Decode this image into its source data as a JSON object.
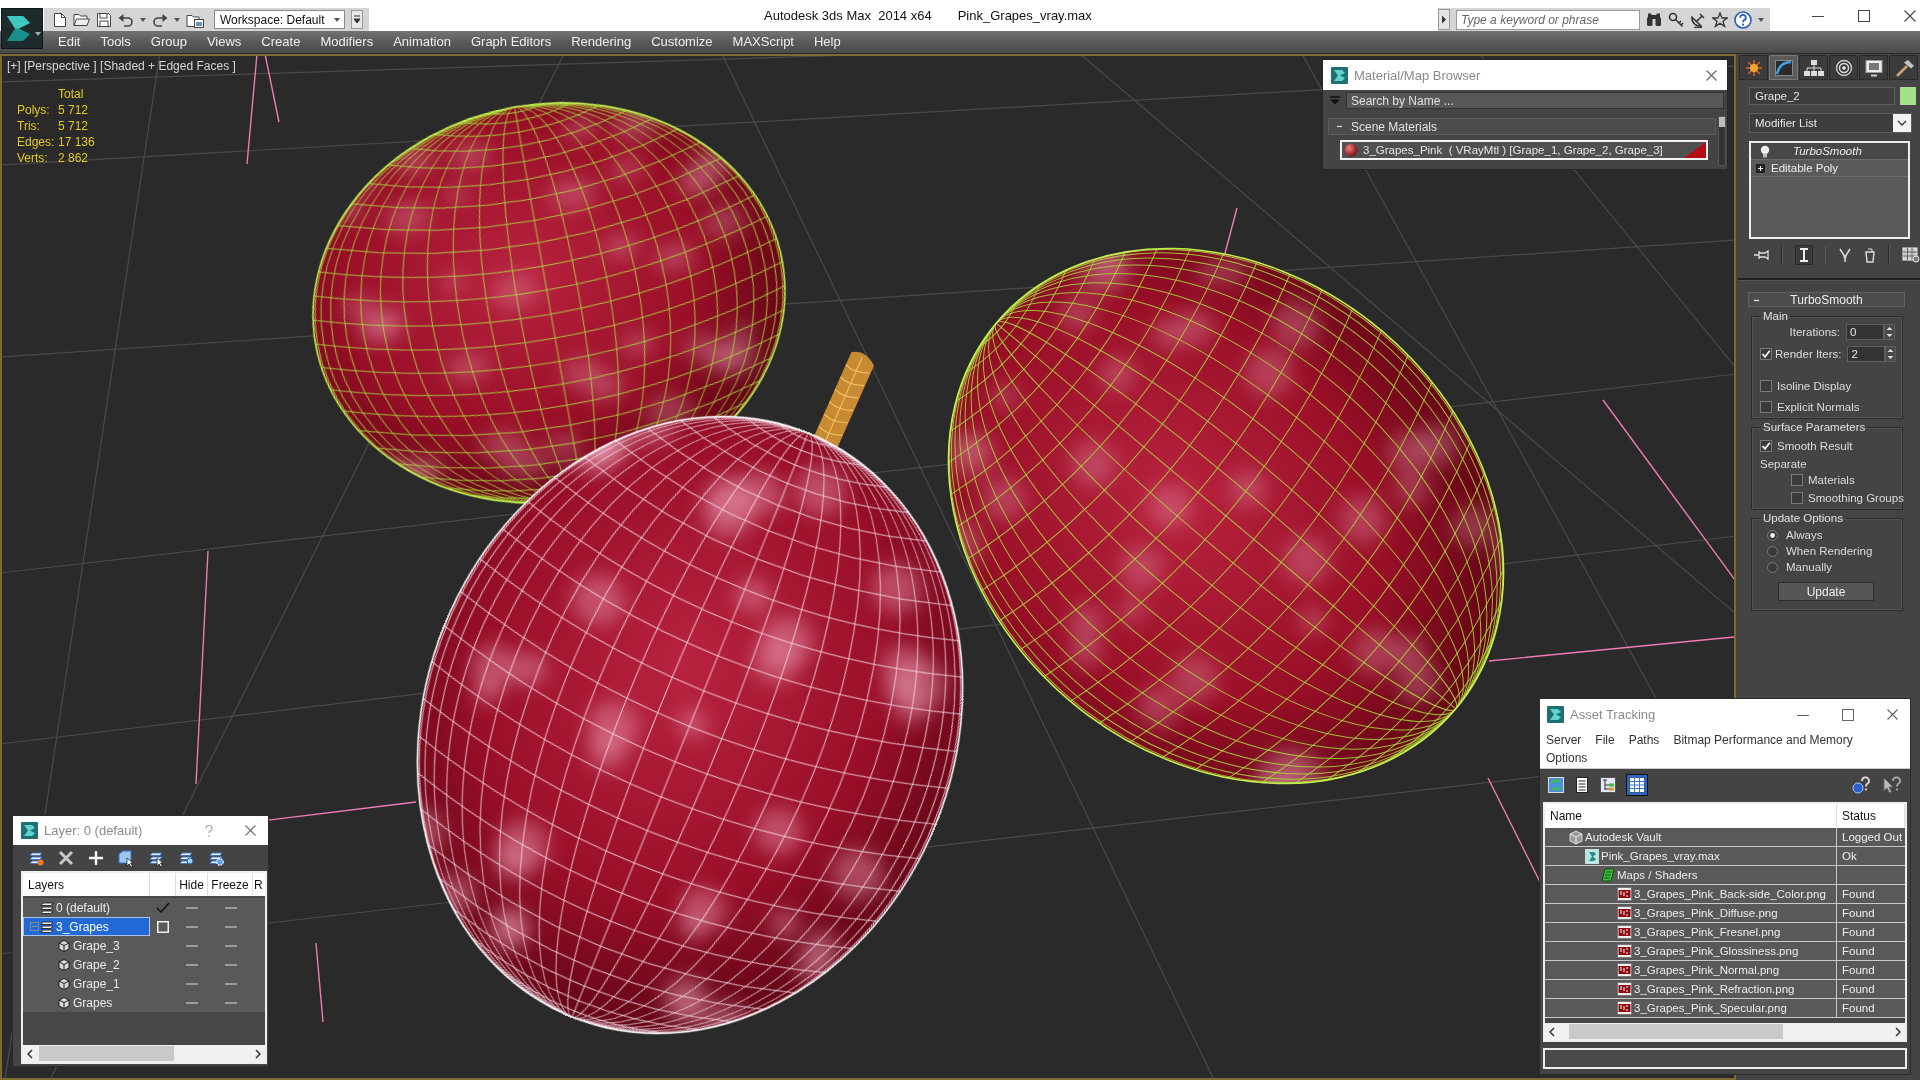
{
  "title_bar": {
    "workspace": "Workspace: Default",
    "app_title": "Autodesk 3ds Max  2014 x64",
    "file_name": "Pink_Grapes_vray.max",
    "search": {
      "placeholder": "Type a keyword or phrase"
    }
  },
  "menu_bar": [
    "Edit",
    "Tools",
    "Group",
    "Views",
    "Create",
    "Modifiers",
    "Animation",
    "Graph Editors",
    "Rendering",
    "Customize",
    "MAXScript",
    "Help"
  ],
  "viewport": {
    "label": "[+] [Perspective ] [Shaded + Edged Faces ]",
    "stats": {
      "header": "Total",
      "rows": [
        {
          "label": "Polys:",
          "value": "5 712"
        },
        {
          "label": "Tris:",
          "value": "5 712"
        },
        {
          "label": "Edges:",
          "value": "17 136"
        },
        {
          "label": "Verts:",
          "value": "2 862"
        }
      ]
    },
    "objects": [
      {
        "selected": false
      },
      {
        "selected": true
      },
      {
        "selected": false
      }
    ]
  },
  "material_browser": {
    "title": "Material/Map Browser",
    "search": {
      "placeholder": "Search by Name ..."
    },
    "group": {
      "title": "Scene Materials",
      "expanded": true,
      "items": [
        {
          "label": "3_Grapes_Pink  ( VRayMtl ) [Grape_1, Grape_2, Grape_3]",
          "selected": true
        }
      ]
    }
  },
  "command_panel": {
    "tabs": [
      {
        "selected": false
      },
      {
        "selected": true
      },
      {
        "selected": false
      },
      {
        "selected": false
      },
      {
        "selected": false
      },
      {
        "selected": false
      }
    ],
    "object_name": "Grape_2",
    "modifier_list": "Modifier List",
    "stack": [
      {
        "label": "TurboSmooth",
        "kind": "modifier",
        "selected": true,
        "italic": true
      },
      {
        "label": "Editable Poly",
        "kind": "base",
        "selected": false,
        "italic": false
      }
    ],
    "rollout": {
      "title": "TurboSmooth",
      "expanded": true,
      "groups": [
        {
          "title": "Main",
          "controls": [
            {
              "kind": "spinner",
              "label": "Iterations:",
              "value": "0"
            },
            {
              "kind": "check_spinner",
              "label": "Render Iters:",
              "value": "2",
              "checked": true
            },
            {
              "kind": "checkbox",
              "label": "Isoline Display",
              "checked": false
            },
            {
              "kind": "checkbox",
              "label": "Explicit Normals",
              "checked": false
            }
          ]
        },
        {
          "title": "Surface Parameters",
          "controls": [
            {
              "kind": "checkbox",
              "label": "Smooth Result",
              "checked": true
            },
            {
              "kind": "label",
              "label": "Separate",
              "children": [
                {
                  "kind": "checkbox",
                  "label": "Materials",
                  "checked": false
                },
                {
                  "kind": "checkbox",
                  "label": "Smoothing Groups",
                  "checked": false
                }
              ]
            }
          ]
        },
        {
          "title": "Update Options",
          "controls": [
            {
              "kind": "radio",
              "label": "Always",
              "selected": true
            },
            {
              "kind": "radio",
              "label": "When Rendering",
              "selected": false
            },
            {
              "kind": "radio",
              "label": "Manually",
              "selected": false
            },
            {
              "kind": "button",
              "label": "Update"
            }
          ]
        }
      ]
    }
  },
  "layer_dialog": {
    "title": "Layer: 0 (default)",
    "columns": [
      "Layers",
      "Hide",
      "Freeze",
      "R"
    ],
    "layers": [
      {
        "name": "0 (default)",
        "kind": "layer",
        "current": true,
        "selected": false,
        "hidden": false,
        "frozen": false
      },
      {
        "name": "3_Grapes",
        "kind": "layer",
        "current": false,
        "selected": true,
        "expanded": true,
        "hidden": false,
        "frozen": false,
        "children": [
          {
            "name": "Grape_3",
            "kind": "object",
            "selected": false,
            "hidden": false,
            "frozen": false
          },
          {
            "name": "Grape_2",
            "kind": "object",
            "selected": false,
            "hidden": false,
            "frozen": false
          },
          {
            "name": "Grape_1",
            "kind": "object",
            "selected": false,
            "hidden": false,
            "frozen": false
          },
          {
            "name": "Grapes",
            "kind": "object",
            "selected": false,
            "hidden": false,
            "frozen": false
          }
        ]
      }
    ]
  },
  "asset_tracking": {
    "title": "Asset Tracking",
    "menu": [
      "Server",
      "File",
      "Paths",
      "Bitmap Performance and Memory",
      "Options"
    ],
    "toolbar": [
      {
        "selected": false
      },
      {
        "selected": false
      },
      {
        "selected": false
      },
      {
        "selected": true
      }
    ],
    "columns": [
      "Name",
      "Status"
    ],
    "tree": [
      {
        "name": "Autodesk Vault",
        "kind": "vault",
        "status": "Logged Out",
        "children": [
          {
            "name": "Pink_Grapes_vray.max",
            "kind": "scene",
            "status": "Ok",
            "children": [
              {
                "name": "Maps / Shaders",
                "kind": "folder",
                "children": [
                  {
                    "name": "3_Grapes_Pink_Back-side_Color.png",
                    "kind": "image",
                    "status": "Found"
                  },
                  {
                    "name": "3_Grapes_Pink_Diffuse.png",
                    "kind": "image",
                    "status": "Found"
                  },
                  {
                    "name": "3_Grapes_Pink_Fresnel.png",
                    "kind": "image",
                    "status": "Found"
                  },
                  {
                    "name": "3_Grapes_Pink_Glossiness.png",
                    "kind": "image",
                    "status": "Found"
                  },
                  {
                    "name": "3_Grapes_Pink_Normal.png",
                    "kind": "image",
                    "status": "Found"
                  },
                  {
                    "name": "3_Grapes_Pink_Refraction.png",
                    "kind": "image",
                    "status": "Found"
                  },
                  {
                    "name": "3_Grapes_Pink_Specular.png",
                    "kind": "image",
                    "status": "Found"
                  }
                ]
              }
            ]
          }
        ]
      }
    ]
  }
}
